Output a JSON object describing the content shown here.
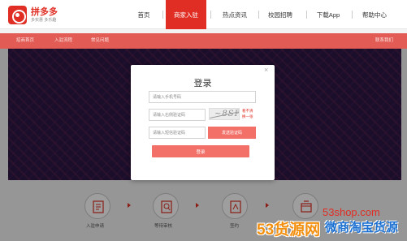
{
  "header": {
    "logo_name": "拼多多",
    "logo_slogan": "多实惠 多乐趣",
    "nav": [
      {
        "label": "首页"
      },
      {
        "label": "商家入驻"
      },
      {
        "label": "热点资讯"
      },
      {
        "label": "校园招聘"
      },
      {
        "label": "下载App"
      },
      {
        "label": "帮助中心"
      }
    ]
  },
  "subnav": {
    "items": [
      {
        "label": "招商首页"
      },
      {
        "label": "入驻流程"
      },
      {
        "label": "常见问题"
      }
    ],
    "contact": "联系我们"
  },
  "steps": [
    {
      "label": "入驻申请",
      "icon": "form-icon"
    },
    {
      "label": "等待审核",
      "icon": "review-icon"
    },
    {
      "label": "签约",
      "icon": "contract-icon"
    },
    {
      "label": "",
      "icon": "shop-icon"
    }
  ],
  "login_modal": {
    "title": "登录",
    "close_symbol": "×",
    "phone_placeholder": "请输入手机号码",
    "image_code_placeholder": "请输入右侧验证码",
    "captcha_text": "~8SP",
    "refresh_text_1": "看不清",
    "refresh_text_2": "换一张",
    "sms_code_placeholder": "请输入短信验证码",
    "sms_button": "发送验证码",
    "login_button": "登录"
  },
  "watermark": {
    "url": "53shop.com",
    "brand": "53货源网",
    "sub": "微商淘宝货源"
  },
  "colors": {
    "brand_red": "#e02e24",
    "button_pink": "#f27068",
    "subnav_red": "#e25c55"
  }
}
